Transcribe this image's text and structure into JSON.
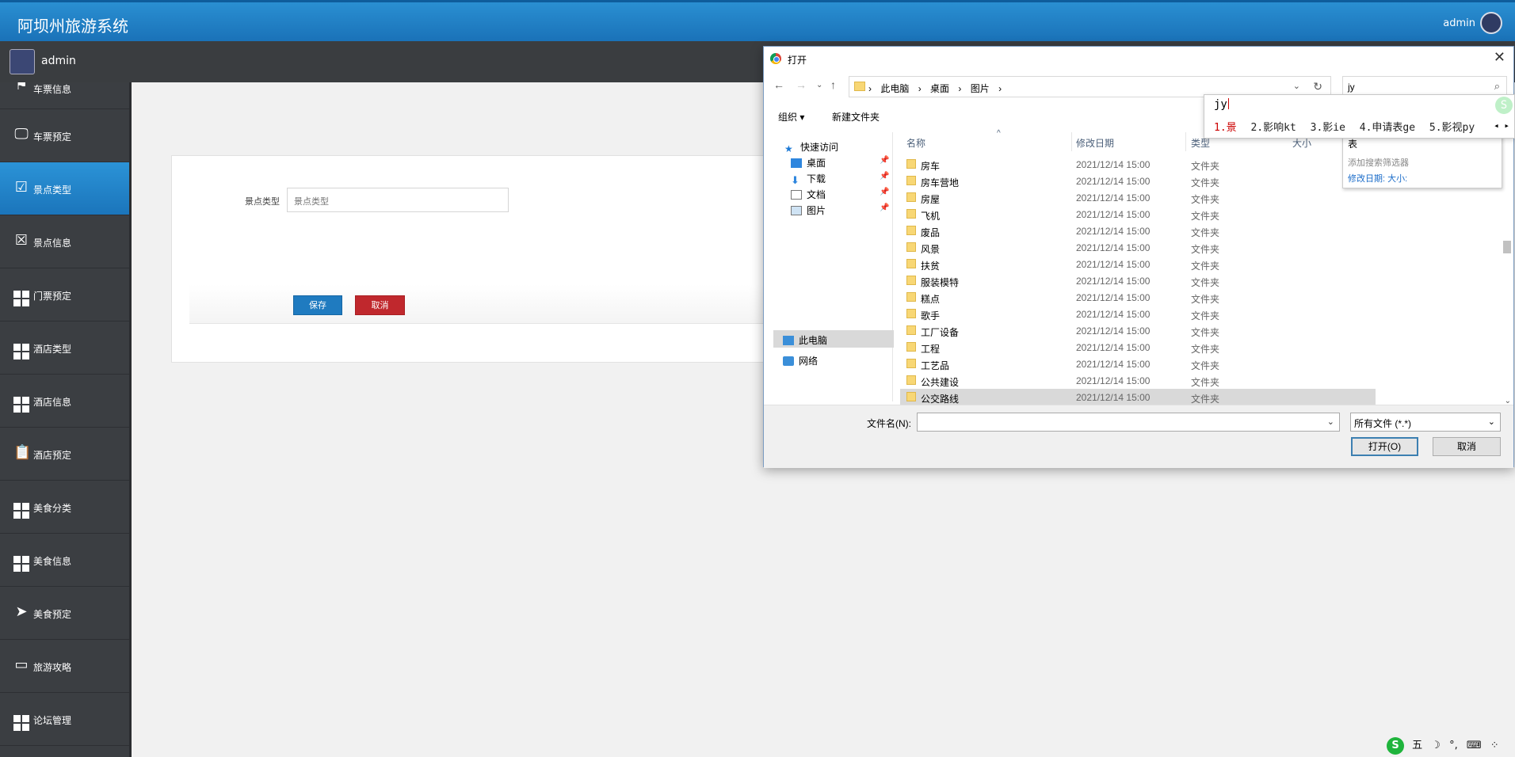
{
  "app": {
    "title": "阿坝州旅游系统",
    "user": "admin"
  },
  "profile": {
    "name": "admin"
  },
  "sidebar": {
    "items": [
      {
        "label": "车票信息"
      },
      {
        "label": "车票预定"
      },
      {
        "label": "景点类型"
      },
      {
        "label": "景点信息"
      },
      {
        "label": "门票预定"
      },
      {
        "label": "酒店类型"
      },
      {
        "label": "酒店信息"
      },
      {
        "label": "酒店预定"
      },
      {
        "label": "美食分类"
      },
      {
        "label": "美食信息"
      },
      {
        "label": "美食预定"
      },
      {
        "label": "旅游攻略"
      },
      {
        "label": "论坛管理"
      }
    ]
  },
  "form": {
    "field_label": "景点类型",
    "field_placeholder": "景点类型",
    "save": "保存",
    "cancel": "取消"
  },
  "dialog": {
    "title": "打开",
    "crumbs": [
      "此电脑",
      "桌面",
      "图片"
    ],
    "search_value": "jy",
    "organize": "组织 ▾",
    "new_folder": "新建文件夹",
    "nav": {
      "quick_access": "快速访问",
      "desktop": "桌面",
      "downloads": "下载",
      "documents": "文档",
      "pictures": "图片",
      "this_pc": "此电脑",
      "network": "网络"
    },
    "columns": {
      "name": "名称",
      "date": "修改日期",
      "type": "类型",
      "size": "大小"
    },
    "rows": [
      {
        "name": "房车",
        "date": "2021/12/14 15:00",
        "type": "文件夹"
      },
      {
        "name": "房车营地",
        "date": "2021/12/14 15:00",
        "type": "文件夹"
      },
      {
        "name": "房屋",
        "date": "2021/12/14 15:00",
        "type": "文件夹"
      },
      {
        "name": "飞机",
        "date": "2021/12/14 15:00",
        "type": "文件夹"
      },
      {
        "name": "废品",
        "date": "2021/12/14 15:00",
        "type": "文件夹"
      },
      {
        "name": "风景",
        "date": "2021/12/14 15:00",
        "type": "文件夹"
      },
      {
        "name": "扶贫",
        "date": "2021/12/14 15:00",
        "type": "文件夹"
      },
      {
        "name": "服装模特",
        "date": "2021/12/14 15:00",
        "type": "文件夹"
      },
      {
        "name": "糕点",
        "date": "2021/12/14 15:00",
        "type": "文件夹"
      },
      {
        "name": "歌手",
        "date": "2021/12/14 15:00",
        "type": "文件夹"
      },
      {
        "name": "工厂设备",
        "date": "2021/12/14 15:00",
        "type": "文件夹"
      },
      {
        "name": "工程",
        "date": "2021/12/14 15:00",
        "type": "文件夹"
      },
      {
        "name": "工艺品",
        "date": "2021/12/14 15:00",
        "type": "文件夹"
      },
      {
        "name": "公共建设",
        "date": "2021/12/14 15:00",
        "type": "文件夹"
      },
      {
        "name": "公交路线",
        "date": "2021/12/14 15:00",
        "type": "文件夹"
      }
    ],
    "filename_label": "文件名(N):",
    "filetype": "所有文件 (*.*)",
    "open": "打开(O)",
    "cancel": "取消"
  },
  "search_popup": {
    "item": "表",
    "hint": "添加搜索筛选器",
    "filters": "修改日期:    大小:"
  },
  "ime": {
    "code": "jy",
    "candidates": [
      "1.景",
      "2.影响kt",
      "3.影ie",
      "4.申请表ge",
      "5.影视py"
    ],
    "logo": "S"
  },
  "tray": {
    "logo": "S",
    "mode": "五",
    "items": [
      "☽",
      "°,",
      "⌨",
      "⁘"
    ]
  }
}
